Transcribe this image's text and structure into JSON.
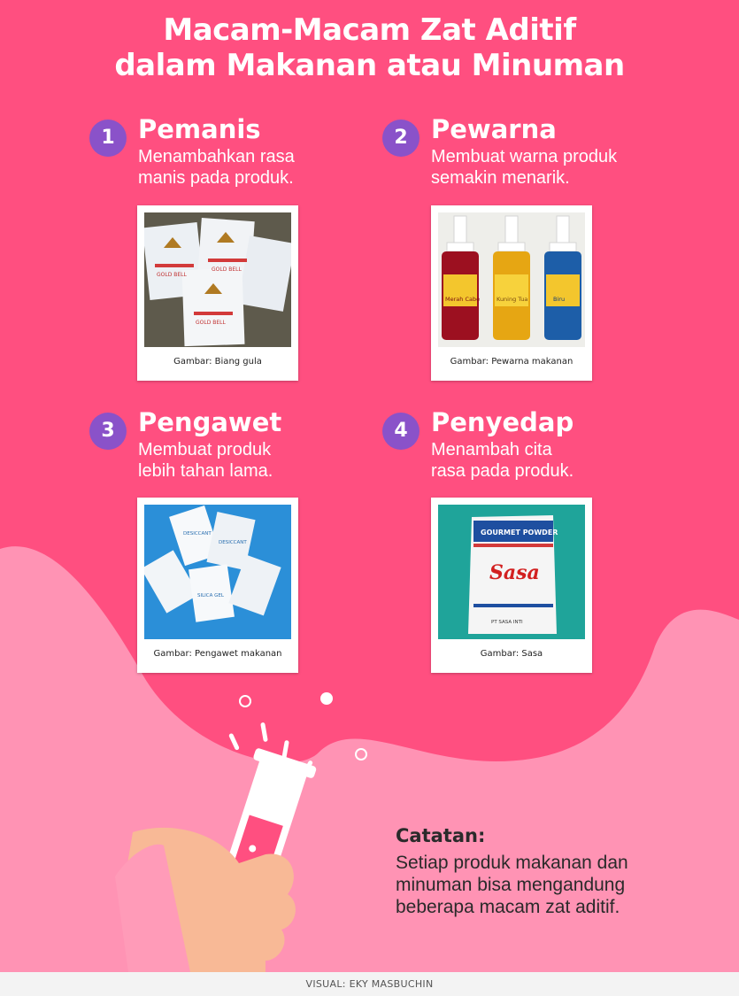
{
  "title": {
    "line1": "Macam-Macam Zat Aditif",
    "line2": "dalam Makanan atau Minuman"
  },
  "items": [
    {
      "number": "1",
      "heading": "Pemanis",
      "desc_line1": "Menambahkan rasa",
      "desc_line2": "manis pada produk.",
      "caption": "Gambar: Biang gula",
      "photo_text": [
        "GOLD BELL",
        "GOLD BELL",
        "GOLD BELL"
      ]
    },
    {
      "number": "2",
      "heading": "Pewarna",
      "desc_line1": "Membuat warna produk",
      "desc_line2": "semakin menarik.",
      "caption": "Gambar: Pewarna makanan",
      "photo_text": [
        "Merah Cabe",
        "Kuning Tua",
        "Biru"
      ]
    },
    {
      "number": "3",
      "heading": "Pengawet",
      "desc_line1": "Membuat produk",
      "desc_line2": "lebih tahan lama.",
      "caption": "Gambar: Pengawet makanan",
      "photo_text": [
        "DESICCANT",
        "DESICCANT",
        "SILICA GEL"
      ]
    },
    {
      "number": "4",
      "heading": "Penyedap",
      "desc_line1": "Menambah cita",
      "desc_line2": "rasa pada produk.",
      "caption": "Gambar: Sasa",
      "photo_text": [
        "GOURMET POWDER",
        "Sasa",
        "PT SASA INTI"
      ]
    }
  ],
  "note": {
    "heading": "Catatan:",
    "line1": "Setiap produk makanan dan",
    "line2": "minuman bisa mengandung",
    "line3": "beberapa macam zat aditif."
  },
  "footer": {
    "credit": "VISUAL: EKY MASBUCHIN"
  },
  "colors": {
    "background": "#ff4f80",
    "splash": "#ff93b4",
    "badge": "#8a52c9",
    "hand": "#f8b996",
    "sleeve": "#ff9bb8",
    "liquid": "#ff4f80"
  }
}
